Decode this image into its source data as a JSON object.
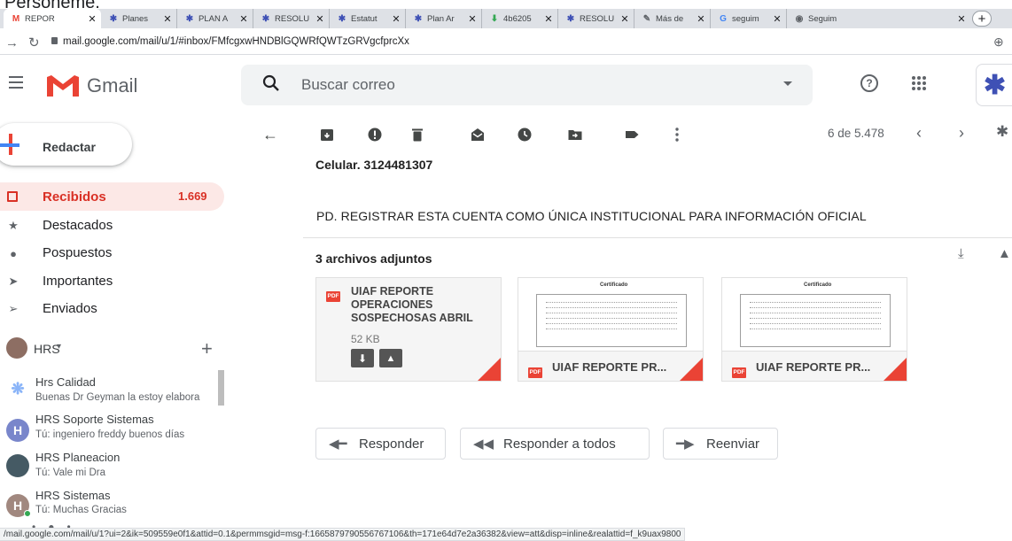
{
  "fragment_text": "Personeme.",
  "browser": {
    "tabs": [
      {
        "label": "REPOR",
        "icon": "gmail-icon"
      },
      {
        "label": "Planes",
        "icon": "org-icon"
      },
      {
        "label": "PLAN A",
        "icon": "org-icon"
      },
      {
        "label": "RESOLU",
        "icon": "org-icon"
      },
      {
        "label": "Estatut",
        "icon": "org-icon"
      },
      {
        "label": "Plan Ar",
        "icon": "org-icon"
      },
      {
        "label": "4b6205",
        "icon": "download-icon"
      },
      {
        "label": "RESOLU",
        "icon": "org-icon"
      },
      {
        "label": "Más de",
        "icon": "pen-icon"
      },
      {
        "label": "seguim",
        "icon": "google-icon"
      },
      {
        "label": "Seguim",
        "icon": "globe-icon"
      }
    ],
    "url": "mail.google.com/mail/u/1/#inbox/FMfcgxwHNDBlGQWRfQWTzGRVgcfprcXx",
    "status_url": "/mail.google.com/mail/u/1?ui=2&ik=509559e0f1&attid=0.1&permmsgid=msg-f:1665879790556767106&th=171e64d7e2a36382&view=att&disp=inline&realattid=f_k9uax9800"
  },
  "header": {
    "product": "Gmail",
    "search_placeholder": "Buscar correo"
  },
  "sidebar": {
    "compose": "Redactar",
    "items": [
      {
        "label": "Recibidos",
        "count": "1.669",
        "icon": "inbox-icon"
      },
      {
        "label": "Destacados",
        "icon": "star-icon"
      },
      {
        "label": "Pospuestos",
        "icon": "clock-icon"
      },
      {
        "label": "Importantes",
        "icon": "important-icon"
      },
      {
        "label": "Enviados",
        "icon": "send-icon"
      }
    ],
    "account": "HRS",
    "chats": [
      {
        "name": "Hrs Calidad",
        "msg": "Buenas Dr Geyman la estoy elabora",
        "avatar": "",
        "color": "#8ab4f8"
      },
      {
        "name": "HRS Soporte Sistemas",
        "msg": "Tú: ingeniero freddy buenos días",
        "avatar": "H",
        "color": "#7986cb"
      },
      {
        "name": "HRS Planeacion",
        "msg": "Tú: Vale mi Dra",
        "avatar": "",
        "color": "#5f6368"
      },
      {
        "name": "HRS Sistemas",
        "msg": "Tú: Muchas Gracias",
        "avatar": "H",
        "color": "#a1887f"
      }
    ]
  },
  "toolbar": {
    "pager": "6 de 5.478"
  },
  "message": {
    "phone": "Celular. 3124481307",
    "pd": "PD. REGISTRAR ESTA CUENTA COMO ÚNICA INSTITUCIONAL PARA INFORMACIÓN OFICIAL",
    "attachments_title": "3 archivos adjuntos",
    "attachments": [
      {
        "title": "UIAF REPORTE OPERACIONES SOSPECHOSAS ABRIL",
        "size": "52 KB",
        "pdf": "PDF"
      },
      {
        "title": "UIAF REPORTE PR...",
        "pdf": "PDF",
        "preview_title": "Certificado"
      },
      {
        "title": "UIAF REPORTE PR...",
        "pdf": "PDF",
        "preview_title": "Certificado"
      }
    ],
    "actions": {
      "reply": "Responder",
      "reply_all": "Responder a todos",
      "forward": "Reenviar"
    }
  },
  "colors": {
    "gmail_red": "#ea4335",
    "inbox_highlight": "#fce8e6",
    "inbox_text": "#d93025"
  }
}
